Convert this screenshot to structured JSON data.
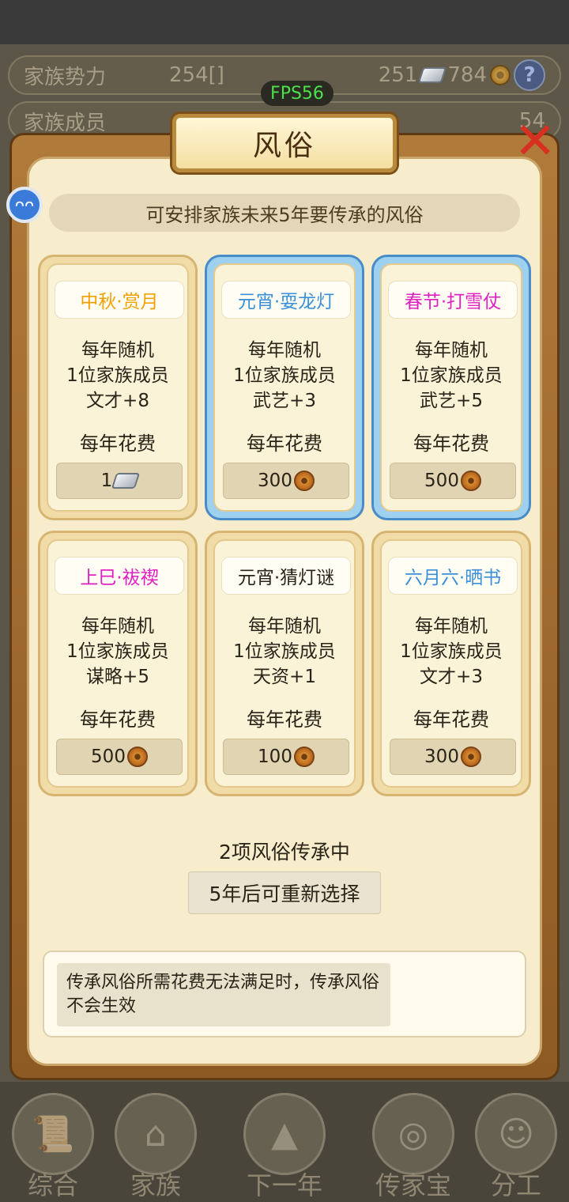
{
  "background": {
    "row1": {
      "label": "家族势力",
      "value": "254[",
      "tag": "",
      "tag_end": "]",
      "silver": "251",
      "copper": "784",
      "help": "?"
    },
    "row2": {
      "label": "家族成员",
      "right": "54"
    },
    "fps": "FPS56"
  },
  "dialog": {
    "title": "风俗",
    "close_glyph": "✕",
    "avatar_glyph": "ᴖᴖ",
    "subtitle": "可安排家族未来5年要传承的风俗",
    "customs": [
      {
        "name": "中秋·赏月",
        "name_color": "#f5a000",
        "line1": "每年随机",
        "line2": "1位家族成员",
        "line3": "文才+8",
        "cost_label": "每年花费",
        "cost": "1",
        "currency": "silver",
        "selected": false
      },
      {
        "name": "元宵·耍龙灯",
        "name_color": "#3a90d8",
        "line1": "每年随机",
        "line2": "1位家族成员",
        "line3": "武艺+3",
        "cost_label": "每年花费",
        "cost": "300",
        "currency": "copper",
        "selected": true
      },
      {
        "name": "春节·打雪仗",
        "name_color": "#e020c0",
        "line1": "每年随机",
        "line2": "1位家族成员",
        "line3": "武艺+5",
        "cost_label": "每年花费",
        "cost": "500",
        "currency": "copper",
        "selected": true
      },
      {
        "name": "上巳·祓禊",
        "name_color": "#e020c0",
        "line1": "每年随机",
        "line2": "1位家族成员",
        "line3": "谋略+5",
        "cost_label": "每年花费",
        "cost": "500",
        "currency": "copper",
        "selected": false
      },
      {
        "name": "元宵·猜灯谜",
        "name_color": "#2a2418",
        "line1": "每年随机",
        "line2": "1位家族成员",
        "line3": "天资+1",
        "cost_label": "每年花费",
        "cost": "100",
        "currency": "copper",
        "selected": false
      },
      {
        "name": "六月六·晒书",
        "name_color": "#3a90d8",
        "line1": "每年随机",
        "line2": "1位家族成员",
        "line3": "文才+3",
        "cost_label": "每年花费",
        "cost": "300",
        "currency": "copper",
        "selected": false
      }
    ],
    "status": "2项风俗传承中",
    "reselect_label": "5年后可重新选择",
    "note": "传承风俗所需花费无法满足时，传承风俗不会生效"
  },
  "bottom_nav": [
    {
      "label": "综合",
      "icon": "scroll-icon"
    },
    {
      "label": "家族",
      "icon": "house-icon"
    },
    {
      "label": "下一年",
      "icon": "mountain-icon"
    },
    {
      "label": "传家宝",
      "icon": "treasure-icon"
    },
    {
      "label": "分工",
      "icon": "people-icon"
    }
  ]
}
